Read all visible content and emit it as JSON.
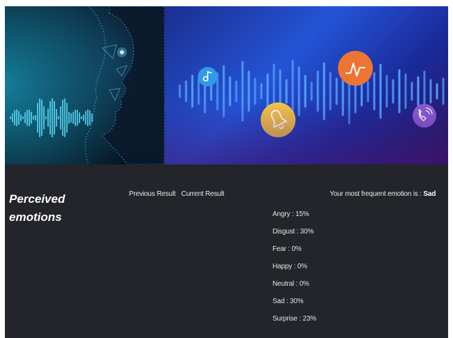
{
  "hero": {
    "icons": [
      "music-note-icon",
      "bell-icon",
      "signal-wave-icon",
      "phone-call-icon"
    ],
    "colors": {
      "face_glow": "#38c8ff",
      "wave_bars": "#5aa8ff",
      "music_bubble": "#2f9be8",
      "bell_bubble": "#f3c548",
      "signal_bubble": "#ee7433",
      "phone_bubble": "#8a5bd6"
    }
  },
  "panel": {
    "title": "Perceived emotions",
    "tabs": [
      "Previous Result",
      "Current Result"
    ],
    "frequent_prefix": "Your most frequent emotion is : ",
    "frequent_value": "Sad",
    "background": "#23252b"
  },
  "emotions": [
    {
      "label": "Angry",
      "percent": "15%"
    },
    {
      "label": "Disgust",
      "percent": "30%"
    },
    {
      "label": "Fear",
      "percent": "0%"
    },
    {
      "label": "Happy",
      "percent": "0%"
    },
    {
      "label": "Neutral",
      "percent": "0%"
    },
    {
      "label": "Sad",
      "percent": "30%"
    },
    {
      "label": "Surprise",
      "percent": "23%"
    }
  ]
}
